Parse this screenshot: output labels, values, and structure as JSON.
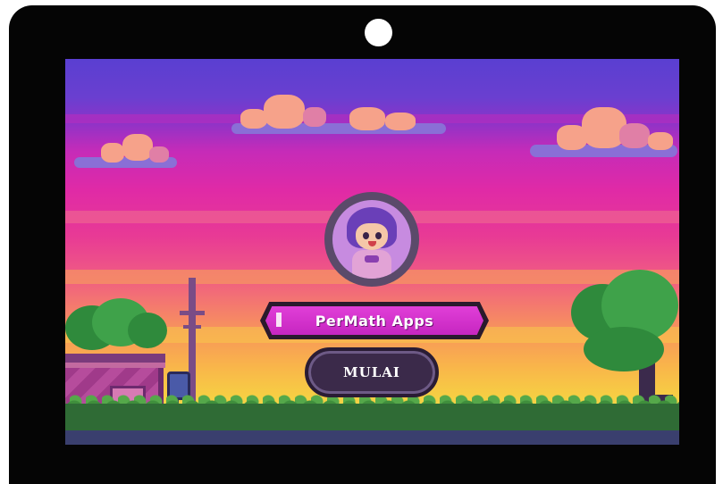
{
  "app": {
    "title": "PerMath Apps",
    "start_label": "MULAI"
  },
  "scene": {
    "avatar": "avatar-character-icon",
    "background": "pixel-art-sunset-park"
  },
  "colors": {
    "banner_fill": "#d232cc",
    "button_fill": "#3b2a4a",
    "device_frame": "#050505",
    "sky_top": "#5a3fd1"
  }
}
